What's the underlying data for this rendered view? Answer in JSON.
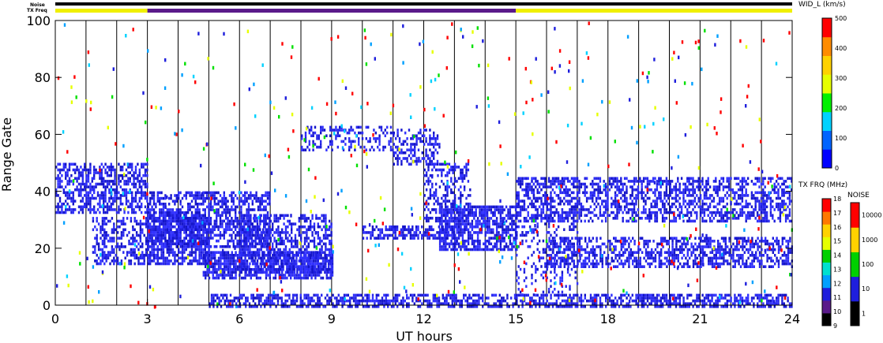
{
  "chart_data": {
    "type": "heatmap",
    "title": "",
    "xlabel": "UT hours",
    "ylabel": "Range Gate",
    "xlim": [
      0,
      24
    ],
    "ylim": [
      0,
      100
    ],
    "xticks": [
      "0",
      "3",
      "6",
      "9",
      "12",
      "15",
      "18",
      "21",
      "24"
    ],
    "yticks": [
      "0",
      "20",
      "40",
      "60",
      "80",
      "100"
    ],
    "scan_boundaries_hours": [
      1,
      2,
      3,
      4,
      5,
      6,
      7,
      8,
      9,
      10,
      11,
      12,
      13,
      14,
      15,
      16,
      17,
      18,
      19,
      20,
      21,
      22,
      23
    ],
    "status_bars": {
      "noise_label": "Noise",
      "txfreq_label": "TX Freq",
      "noise_color": "#000000",
      "txfreq_segments": [
        {
          "start": 0,
          "end": 3,
          "color": "#f0f000"
        },
        {
          "start": 3,
          "end": 15,
          "color": "#5a1a8a"
        },
        {
          "start": 15,
          "end": 24,
          "color": "#f0f000"
        }
      ]
    },
    "scatter_bands": [
      {
        "name": "early 36-50",
        "x": [
          0,
          3
        ],
        "y": [
          33,
          50
        ],
        "density": 0.55
      },
      {
        "name": "early 17-30",
        "x": [
          1.2,
          3
        ],
        "y": [
          15,
          31
        ],
        "density": 0.45
      },
      {
        "name": "morning upper",
        "x": [
          3,
          7
        ],
        "y": [
          21,
          40
        ],
        "density": 0.6
      },
      {
        "name": "morning lower",
        "x": [
          3,
          5
        ],
        "y": [
          15,
          33
        ],
        "density": 0.7
      },
      {
        "name": "midday lower",
        "x": [
          4.8,
          9
        ],
        "y": [
          10,
          19
        ],
        "density": 0.75
      },
      {
        "name": "midday main",
        "x": [
          6,
          9
        ],
        "y": [
          12,
          32
        ],
        "density": 0.55
      },
      {
        "name": "bottom gates",
        "x": [
          5,
          24
        ],
        "y": [
          0,
          4
        ],
        "density": 0.6
      },
      {
        "name": "arc rising",
        "x": [
          8,
          11
        ],
        "y": [
          55,
          63
        ],
        "density": 0.3
      },
      {
        "name": "arc peak",
        "x": [
          11,
          12.5
        ],
        "y": [
          50,
          62
        ],
        "density": 0.4
      },
      {
        "name": "arc descending",
        "x": [
          12,
          13.5
        ],
        "y": [
          30,
          50
        ],
        "density": 0.45
      },
      {
        "name": "post-noon band",
        "x": [
          12.5,
          15
        ],
        "y": [
          20,
          35
        ],
        "density": 0.7
      },
      {
        "name": "mid band 26",
        "x": [
          10,
          13
        ],
        "y": [
          24,
          28
        ],
        "density": 0.6
      },
      {
        "name": "evening upper",
        "x": [
          15,
          24
        ],
        "y": [
          30,
          45
        ],
        "density": 0.5
      },
      {
        "name": "evening lower",
        "x": [
          16,
          24
        ],
        "y": [
          14,
          24
        ],
        "density": 0.55
      },
      {
        "name": "evening scatter",
        "x": [
          15,
          17
        ],
        "y": [
          4,
          45
        ],
        "density": 0.2
      }
    ],
    "colorbars": {
      "velocity_width": {
        "label": "WID_L (km/s)",
        "range": [
          0,
          500
        ],
        "ticks": [
          "500",
          "400",
          "300",
          "200",
          "100",
          "0"
        ],
        "colors": [
          "#0000ff",
          "#0064ff",
          "#00d2ff",
          "#00f000",
          "#e6ff00",
          "#ffd200",
          "#ff8c00",
          "#ff0000"
        ]
      },
      "tx_freq": {
        "label": "TX FRQ (MHz)",
        "ticks": [
          "18",
          "17",
          "16",
          "15",
          "14",
          "13",
          "12",
          "11",
          "10",
          "9"
        ],
        "colors": [
          "#000000",
          "#5a1a8a",
          "#1e1edc",
          "#00a0ff",
          "#00e0d0",
          "#00d000",
          "#e6ff00",
          "#ffd200",
          "#ff7800",
          "#ff0000"
        ]
      },
      "noise": {
        "label": "NOISE",
        "ticks": [
          "10000",
          "1000",
          "100",
          "10",
          "1"
        ],
        "colors": [
          "#000000",
          "#1e1edc",
          "#00d000",
          "#ffd200",
          "#ff0000"
        ]
      }
    }
  }
}
